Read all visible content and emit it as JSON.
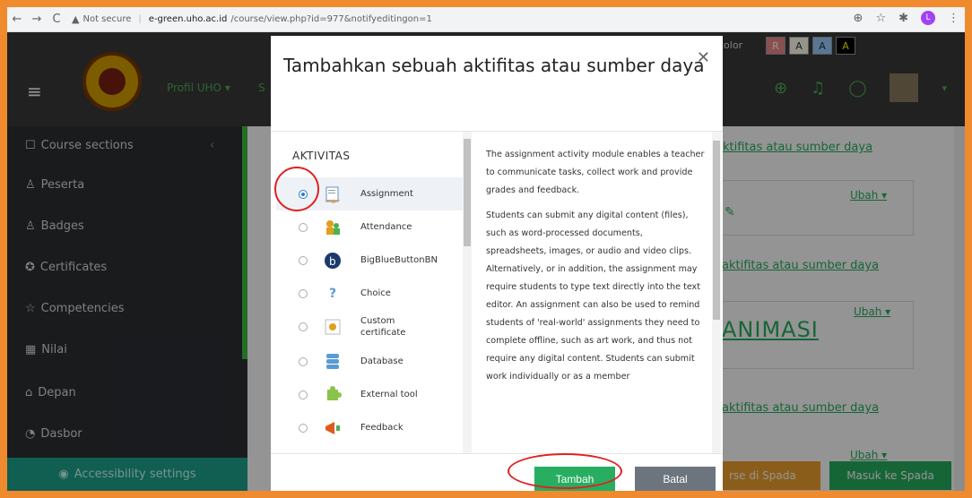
{
  "browser": {
    "security": "Not secure",
    "url_host": "e-green.uho.ac.id",
    "url_path": "/course/view.php?id=977&notifyeditingon=1"
  },
  "topnav": {
    "profil": "Profil UHO",
    "nav_s": "S",
    "color_label": "color",
    "color_buttons": [
      "R",
      "A",
      "A",
      "A"
    ]
  },
  "sidebar": {
    "items": [
      {
        "icon": "☐",
        "label": "Course sections"
      },
      {
        "icon": "♙",
        "label": "Peserta"
      },
      {
        "icon": "♙",
        "label": "Badges"
      },
      {
        "icon": "✪",
        "label": "Certificates"
      },
      {
        "icon": "☆",
        "label": "Competencies"
      },
      {
        "icon": "▦",
        "label": "Nilai"
      },
      {
        "icon": "⌂",
        "label": "Depan"
      },
      {
        "icon": "◔",
        "label": "Dasbor"
      }
    ],
    "accessibility": "Accessibility settings"
  },
  "main": {
    "link1": "aktifitas atau sumber daya",
    "link2": "aktifitas atau sumber daya",
    "link3": "aktifitas atau sumber daya",
    "ubah1": "Ubah",
    "ubah2": "Ubah",
    "ubah3": "Ubah",
    "animasi": "ANIMASI",
    "btn_orange": "rse di Spada",
    "btn_green": "Masuk ke Spada"
  },
  "modal": {
    "title": "Tambahkan sebuah aktifitas atau sumber daya",
    "section_head": "AKTIVITAS",
    "options": [
      {
        "label": "Assignment",
        "selected": true,
        "icon": "assignment-icon"
      },
      {
        "label": "Attendance",
        "selected": false,
        "icon": "attendance-icon"
      },
      {
        "label": "BigBlueButtonBN",
        "selected": false,
        "icon": "bigbluebutton-icon"
      },
      {
        "label": "Choice",
        "selected": false,
        "icon": "choice-icon"
      },
      {
        "label": "Custom certificate",
        "selected": false,
        "icon": "certificate-icon"
      },
      {
        "label": "Database",
        "selected": false,
        "icon": "database-icon"
      },
      {
        "label": "External tool",
        "selected": false,
        "icon": "external-tool-icon"
      },
      {
        "label": "Feedback",
        "selected": false,
        "icon": "feedback-icon"
      }
    ],
    "desc_p1": "The assignment activity module enables a teacher to communicate tasks, collect work and provide grades and feedback.",
    "desc_p2": "Students can submit any digital content (files), such as word-processed documents, spreadsheets, images, or audio and video clips. Alternatively, or in addition, the assignment may require students to type text directly into the text editor. An assignment can also be used to remind students of 'real-world' assignments they need to complete offline, such as art work, and thus not require any digital content. Students can submit work individually or as a member",
    "btn_tambah": "Tambah",
    "btn_batal": "Batal"
  }
}
